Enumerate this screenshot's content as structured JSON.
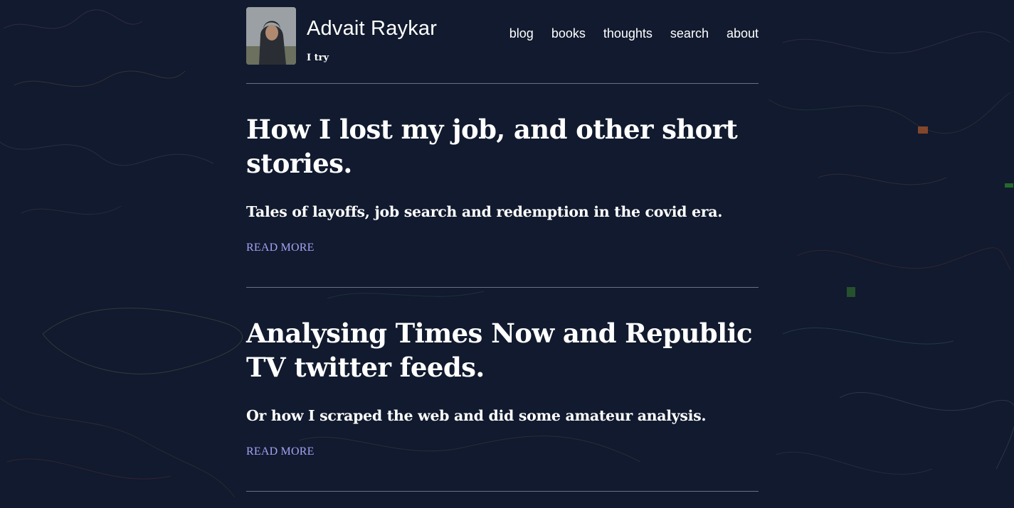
{
  "site": {
    "title": "Advait Raykar",
    "tagline": "I try"
  },
  "nav": {
    "items": [
      "blog",
      "books",
      "thoughts",
      "search",
      "about"
    ]
  },
  "posts": [
    {
      "title": "How I lost my job, and other short stories.",
      "subtitle": "Tales of layoffs, job search and redemption in the covid era.",
      "read_more": "READ MORE"
    },
    {
      "title": "Analysing Times Now and Republic TV twitter feeds.",
      "subtitle": "Or how I scraped the web and did some amateur analysis.",
      "read_more": "READ MORE"
    }
  ],
  "colors": {
    "background": "#111a2e",
    "link": "#a5a2f5",
    "divider": "#6b6f86"
  }
}
